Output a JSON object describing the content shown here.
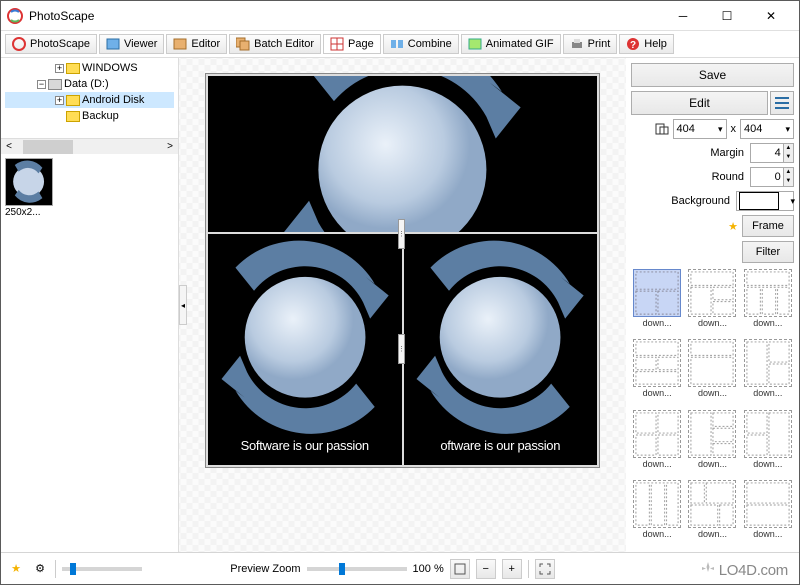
{
  "window": {
    "title": "PhotoScape"
  },
  "tabs": [
    {
      "label": "PhotoScape"
    },
    {
      "label": "Viewer"
    },
    {
      "label": "Editor"
    },
    {
      "label": "Batch Editor"
    },
    {
      "label": "Page"
    },
    {
      "label": "Combine"
    },
    {
      "label": "Animated GIF"
    },
    {
      "label": "Print"
    },
    {
      "label": "Help"
    }
  ],
  "tree": {
    "items": [
      {
        "label": "WINDOWS",
        "level": 2,
        "exp": "+"
      },
      {
        "label": "Data (D:)",
        "level": 1,
        "exp": "−"
      },
      {
        "label": "Android Disk",
        "level": 2,
        "exp": "+",
        "sel": true
      },
      {
        "label": "Backup",
        "level": 2,
        "exp": ""
      }
    ]
  },
  "thumbnail": {
    "label": "250x2..."
  },
  "canvas": {
    "caption_left": "Software is our passion",
    "caption_right": "oftware is our passion"
  },
  "right": {
    "save": "Save",
    "edit": "Edit",
    "width": "404",
    "x": "x",
    "height": "404",
    "margin_label": "Margin",
    "margin_val": "4",
    "round_label": "Round",
    "round_val": "0",
    "background_label": "Background",
    "frame": "Frame",
    "filter": "Filter"
  },
  "layouts": {
    "label": "down..."
  },
  "status": {
    "preview_zoom": "Preview Zoom",
    "zoom_value": "100 %"
  },
  "watermark": "LO4D.com"
}
